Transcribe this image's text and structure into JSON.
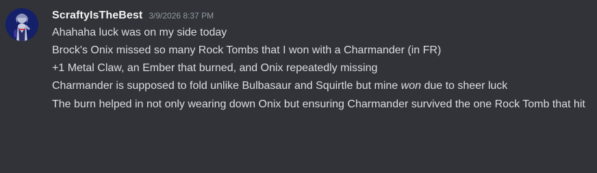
{
  "message": {
    "author": "ScraftyIsTheBest",
    "timestamp": "3/9/2026 8:37 PM",
    "lines": [
      "Ahahaha luck was on my side today",
      "Brock's Onix missed so many Rock Tombs that I won with a Charmander (in FR)",
      "+1 Metal Claw, an Ember that burned, and Onix repeatedly missing"
    ],
    "line4": {
      "before": "Charmander is supposed to fold unlike Bulbasaur and Squirtle but mine ",
      "emphasis": "won",
      "after": " due to sheer luck"
    },
    "line5": "The burn helped in not only wearing down Onix but ensuring Charmander survived the one Rock Tomb that hit"
  },
  "colors": {
    "background": "#313338",
    "username": "#f2f3f5",
    "timestamp": "#949ba4",
    "text": "#dbdee1"
  },
  "icons": {
    "avatar": "anime-character-avatar"
  }
}
